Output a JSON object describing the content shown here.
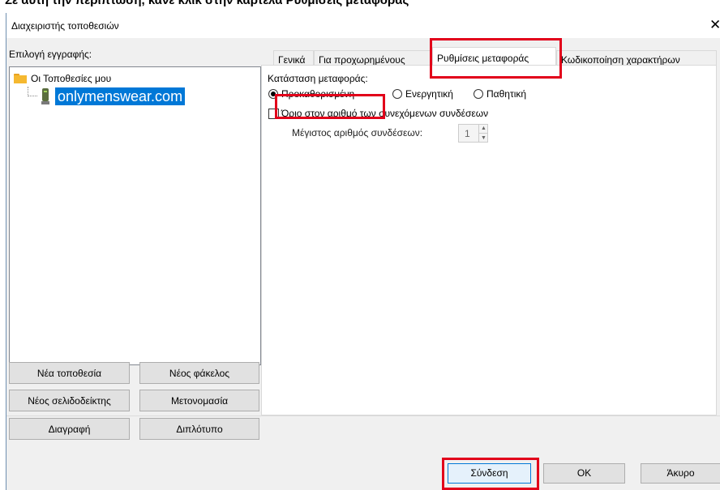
{
  "header_strip": {
    "text": "Σε αυτή την περίπτωση, κάνε κλικ στην καρτέλα Ρυθμίσεις μεταφοράς"
  },
  "window": {
    "title": "Διαχειριστής τοποθεσιών",
    "close_glyph": "✕"
  },
  "left": {
    "select_label": "Επιλογή εγγραφής:",
    "tree": {
      "root": "Οι Τοποθεσίες μου",
      "site": "onlymenswear.com"
    },
    "buttons": {
      "new_site": "Νέα τοποθεσία",
      "new_folder": "Νέος φάκελος",
      "new_bookmark": "Νέος σελιδοδείκτης",
      "rename": "Μετονομασία",
      "delete": "Διαγραφή",
      "duplicate": "Διπλότυπο"
    }
  },
  "tabs": [
    {
      "label": "Γενικά"
    },
    {
      "label": "Για προχωρημένους"
    },
    {
      "label": "Ρυθμίσεις μεταφοράς"
    },
    {
      "label": "Κωδικοποίηση χαρακτήρων"
    }
  ],
  "transfer": {
    "mode_label": "Κατάσταση μεταφοράς:",
    "modes": [
      "Προκαθορισμένη",
      "Ενεργητική",
      "Παθητική"
    ],
    "selected_mode": "Προκαθορισμένη",
    "limit_label": "Όριο στον αριθμό των συνεχόμενων συνδέσεων",
    "limit_checked": false,
    "max_label": "Μέγιστος αριθμός συνδέσεων:",
    "max_value": "1"
  },
  "footer": {
    "connect": "Σύνδεση",
    "ok": "OK",
    "cancel": "Άκυρο"
  },
  "icons": [
    "folder-icon",
    "server-icon",
    "close-icon",
    "spinner-up-icon",
    "spinner-down-icon"
  ],
  "colors": {
    "highlight": "#e2001a",
    "selection": "#0078d7"
  }
}
